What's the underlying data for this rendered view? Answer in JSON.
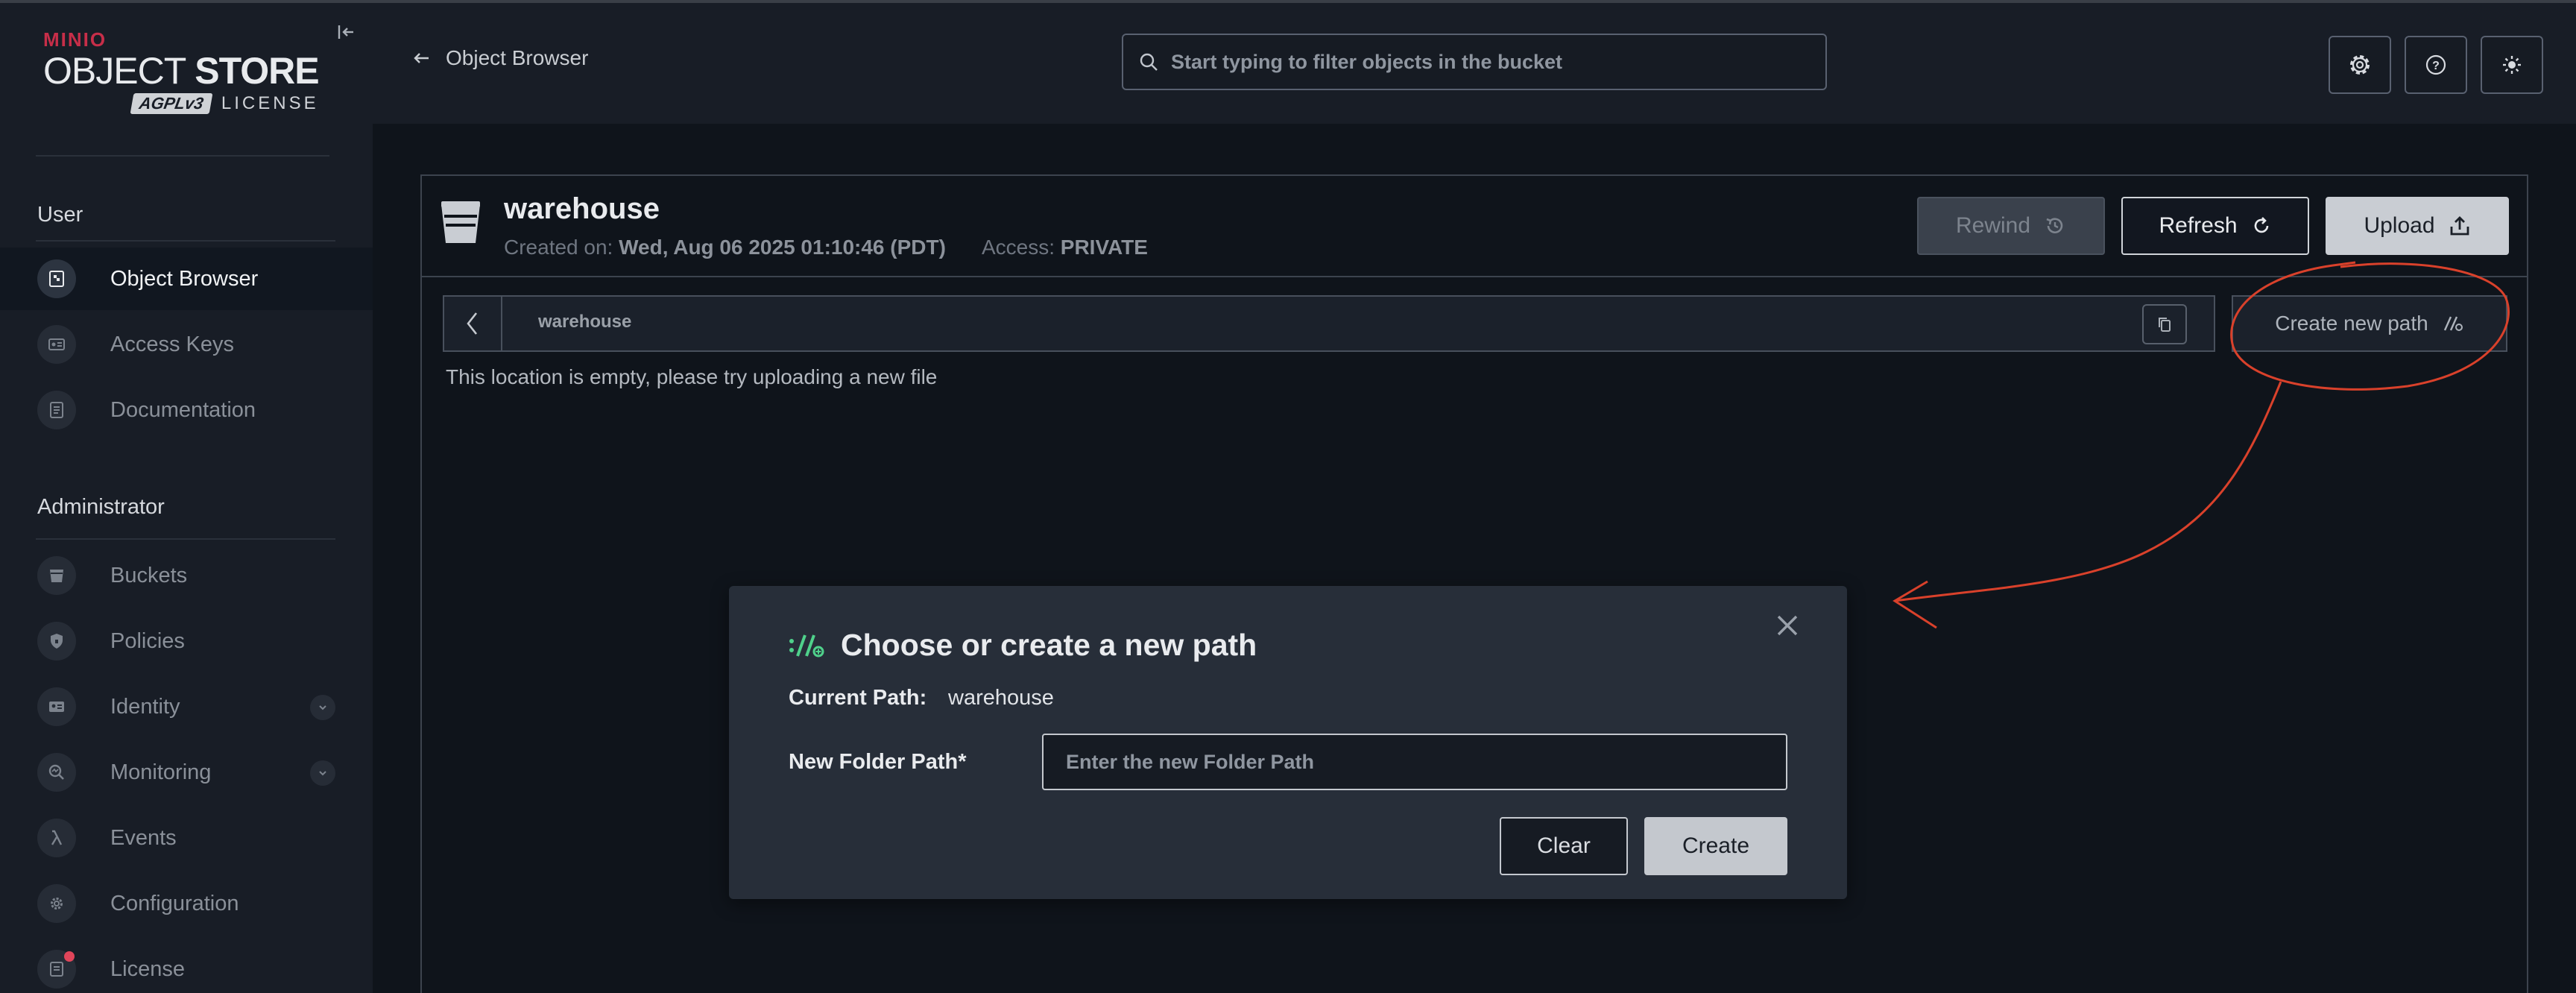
{
  "brand": {
    "company": "MINIO",
    "product_light": "OBJECT",
    "product_bold": "STORE",
    "license_badge": "AGPLv3",
    "license_word": "LICENSE"
  },
  "sidebar": {
    "groups": {
      "user": "User",
      "admin": "Administrator"
    },
    "user_items": [
      {
        "label": "Object Browser",
        "icon": "object-browser-icon",
        "active": true
      },
      {
        "label": "Access Keys",
        "icon": "access-keys-icon"
      },
      {
        "label": "Documentation",
        "icon": "documentation-icon"
      }
    ],
    "admin_items": [
      {
        "label": "Buckets",
        "icon": "bucket-icon"
      },
      {
        "label": "Policies",
        "icon": "policy-shield-icon"
      },
      {
        "label": "Identity",
        "icon": "identity-card-icon",
        "expandable": true
      },
      {
        "label": "Monitoring",
        "icon": "monitoring-icon",
        "expandable": true
      },
      {
        "label": "Events",
        "icon": "lambda-icon"
      },
      {
        "label": "Configuration",
        "icon": "gear-icon"
      },
      {
        "label": "License",
        "icon": "license-icon",
        "badge_dot": true
      }
    ]
  },
  "header": {
    "back_label": "Object Browser",
    "search_placeholder": "Start typing to filter objects in the bucket",
    "buttons": [
      "settings-icon",
      "help-icon",
      "theme-toggle-icon"
    ]
  },
  "bucket": {
    "name": "warehouse",
    "created_label": "Created on:",
    "created_value": "Wed, Aug 06 2025 01:10:46 (PDT)",
    "access_label": "Access:",
    "access_value": "PRIVATE",
    "rewind_label": "Rewind",
    "refresh_label": "Refresh",
    "upload_label": "Upload",
    "path": "warehouse",
    "create_path_label": "Create new path",
    "empty_message": "This location is empty, please try uploading a new file"
  },
  "modal": {
    "title": "Choose or create a new path",
    "current_path_label": "Current Path:",
    "current_path_value": "warehouse",
    "new_folder_label": "New Folder Path*",
    "new_folder_placeholder": "Enter the new Folder Path",
    "clear_label": "Clear",
    "create_label": "Create"
  },
  "colors": {
    "accent_green": "#4fd18b",
    "brand_red": "#c72e49",
    "annotation_red": "#d9412b",
    "background": "#0f141b",
    "sidebar": "#181d26"
  }
}
